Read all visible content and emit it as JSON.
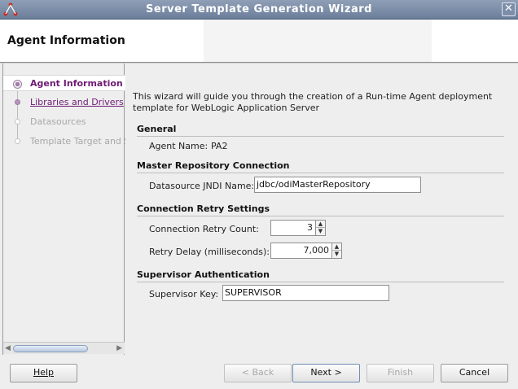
{
  "window": {
    "title": "Server Template Generation Wizard"
  },
  "header": {
    "heading": "Agent Information"
  },
  "nav": {
    "steps": [
      {
        "label": "Agent Information",
        "state": "active"
      },
      {
        "label": "Libraries and Drivers",
        "state": "link"
      },
      {
        "label": "Datasources",
        "state": "disabled"
      },
      {
        "label": "Template Target and Summary",
        "state": "disabled"
      }
    ]
  },
  "intro": "This wizard will guide you through the creation of a Run-time Agent deployment template for WebLogic Application Server",
  "general": {
    "title": "General",
    "agent_name_label": "Agent Name:",
    "agent_name_value": "PA2"
  },
  "master_repo": {
    "title": "Master Repository Connection",
    "jndi_label": "Datasource JNDI Name:",
    "jndi_value": "jdbc/odiMasterRepository"
  },
  "retry": {
    "title": "Connection Retry Settings",
    "count_label": "Connection Retry Count:",
    "count_value": "3",
    "delay_label": "Retry Delay (milliseconds):",
    "delay_value": "7,000"
  },
  "supervisor": {
    "title": "Supervisor Authentication",
    "key_label": "Supervisor Key:",
    "key_value": "SUPERVISOR"
  },
  "buttons": {
    "help": "Help",
    "back": "< Back",
    "next": "Next >",
    "finish": "Finish",
    "cancel": "Cancel"
  },
  "colors": {
    "accent": "#6e1b74",
    "titlebar": "#7c8ea9"
  }
}
